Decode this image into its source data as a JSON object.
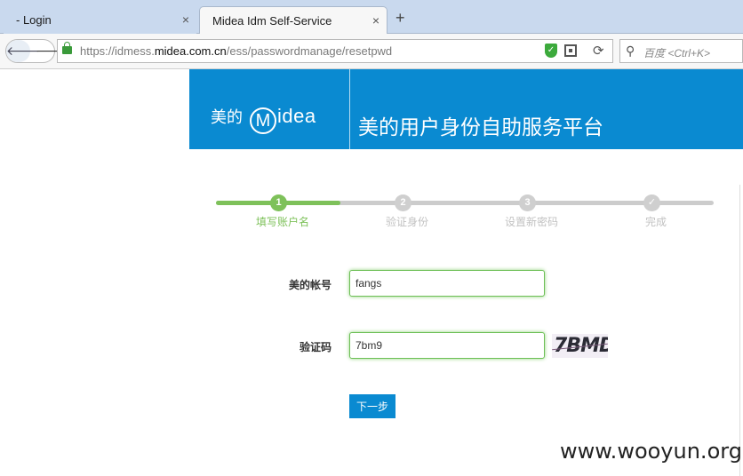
{
  "tabs": [
    {
      "label": "- Login",
      "close": "×"
    },
    {
      "label": "Midea Idm Self-Service",
      "close": "×"
    }
  ],
  "new_tab": "+",
  "nav": {
    "back": "🡐",
    "forward": "🡒",
    "url_prefix": "https://idmess.",
    "url_domain": "midea.com.cn",
    "url_path": "/ess/passwordmanage/resetpwd",
    "reload": "⟳",
    "search_placeholder": "百度 <Ctrl+K>"
  },
  "icons": [
    "lock-icon",
    "shield-icon",
    "qr-code-icon",
    "reload-icon",
    "search-icon",
    "check-icon"
  ],
  "colors": {
    "brand": "#0a8ad1",
    "step_done": "#7ec15a",
    "step_pending": "#cccccc"
  },
  "header": {
    "logo_cn": "美的",
    "logo_m": "M",
    "logo_en": "idea",
    "title": "美的用户身份自助服务平台"
  },
  "steps": [
    {
      "num": "1",
      "label": "填写账户名",
      "status": "done"
    },
    {
      "num": "2",
      "label": "验证身份",
      "status": "pending"
    },
    {
      "num": "3",
      "label": "设置新密码",
      "status": "pending"
    },
    {
      "num": "✓",
      "label": "完成",
      "status": "pending"
    }
  ],
  "form": {
    "account_label": "美的帐号",
    "account_value": "fangs",
    "captcha_label": "验证码",
    "captcha_value": "7bm9",
    "captcha_image_text": "7BMD",
    "next_button": "下一步"
  },
  "watermark": "www.wooyun.org"
}
